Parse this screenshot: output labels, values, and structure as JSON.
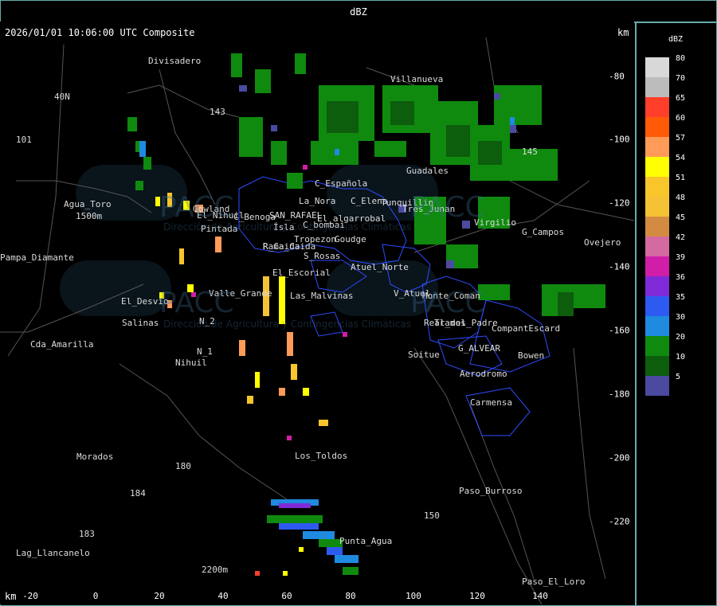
{
  "header": {
    "title": "dBZ"
  },
  "map": {
    "timestamp_label": "2026/01/01 10:06:00 UTC Composite",
    "unit_top": "km",
    "unit_bottom": "km",
    "x_ticks": [
      "-20",
      "0",
      "20",
      "40",
      "60",
      "80",
      "100",
      "120",
      "140"
    ],
    "y_ticks": [
      "-80",
      "-100",
      "-120",
      "-140",
      "-160",
      "-180",
      "-200",
      "-220"
    ],
    "places": [
      "Divisadero",
      "Villanueva",
      "Guadales",
      "C_Española",
      "La_Nora",
      "C_Elena",
      "Tunquillin",
      "Tres_Junan",
      "Virgilio",
      "C_Benoga",
      "SAN_RAFAEL",
      "El_algarrobal",
      "C_bombai",
      "Gowland",
      "Pintada",
      "Ísla",
      "Tropezon",
      "Goudge",
      "R_Caida",
      "S_Rosas",
      "El_Nihuil",
      "Rama_Caida",
      "Agua_Toro",
      "Pampa_Diamante",
      "El_Escorial",
      "Atuel_Norte",
      "Valle_Grande",
      "V_Atuel",
      "El_Desvio",
      "Salinas",
      "Las_Malvinas",
      "Real_del_Padre",
      "Monte_Coman",
      "Cda_Amarilla",
      "N_2",
      "N_1",
      "Nihuil",
      "Soitue",
      "G_ALVEAR",
      "Bowen",
      "Aerodromo",
      "Carmensa",
      "Los_Toldos",
      "Morados",
      "Paso_Burroso",
      "Punta_Agua",
      "Lag_Llancanelo",
      "Paso_El_Loro",
      "G_Campos",
      "Ovejero",
      "CompantEscard",
      "Tramos",
      "40N",
      "101",
      "143",
      "145",
      "1500m",
      "2200m",
      "180",
      "184",
      "150",
      "183"
    ],
    "watermark": "PACC",
    "watermark_sub": "Dirección de Agricultura y Contingencias Climáticas"
  },
  "legend": {
    "title": "dBZ",
    "levels": [
      {
        "label": "80",
        "color": "#d8d8d8"
      },
      {
        "label": "70",
        "color": "#bcbcbc"
      },
      {
        "label": "65",
        "color": "#ff3f2a"
      },
      {
        "label": "60",
        "color": "#ff5a08"
      },
      {
        "label": "57",
        "color": "#ff9a58"
      },
      {
        "label": "54",
        "color": "#ffff00"
      },
      {
        "label": "51",
        "color": "#f8c52b"
      },
      {
        "label": "48",
        "color": "#f4c234"
      },
      {
        "label": "45",
        "color": "#d38b42"
      },
      {
        "label": "42",
        "color": "#d46aa0"
      },
      {
        "label": "39",
        "color": "#d01ea8"
      },
      {
        "label": "36",
        "color": "#7f2ad8"
      },
      {
        "label": "35",
        "color": "#2d5af0"
      },
      {
        "label": "30",
        "color": "#1e8ae0"
      },
      {
        "label": "20",
        "color": "#0f8a0f"
      },
      {
        "label": "10",
        "color": "#0c5d0c"
      },
      {
        "label": "5",
        "color": "#4b4aa0"
      }
    ]
  }
}
